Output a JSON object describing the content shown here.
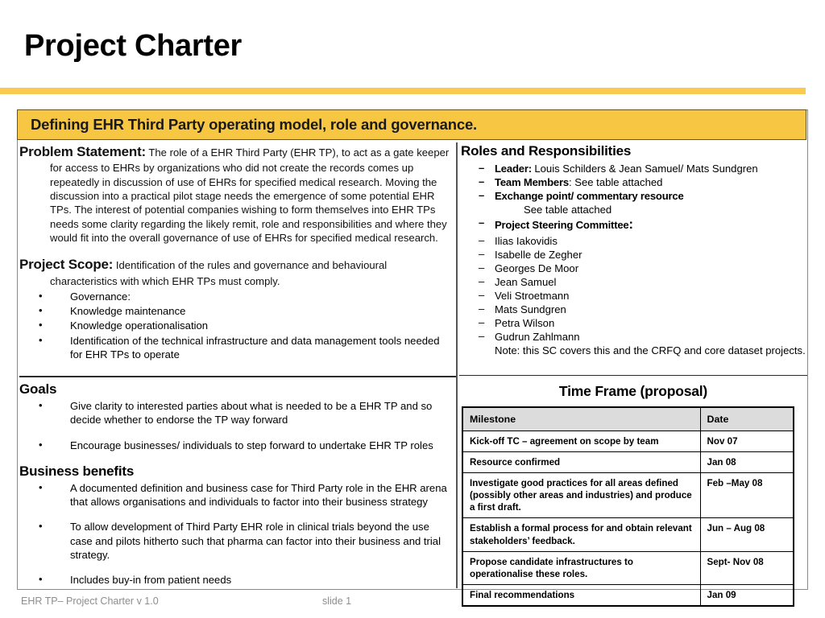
{
  "slide": {
    "title": "Project Charter",
    "banner": "Defining EHR Third Party operating model, role and governance.",
    "accent_color": "#FBCB4F",
    "banner_color": "#F7C642"
  },
  "problem": {
    "label": "Problem Statement:",
    "text": "The role of a EHR Third Party (EHR TP), to act as a gate keeper for access to EHRs by organizations who did not create the records comes up repeatedly in discussion of use of EHRs for specified medical research. Moving the discussion into a practical pilot stage needs the emergence of some potential EHR TPs. The interest of potential companies wishing to form themselves into EHR TPs needs some clarity regarding the likely remit, role and responsibilities and where they would fit into the overall governance of use of EHRs for specified medical research."
  },
  "scope": {
    "label": "Project Scope:",
    "text": "Identification of the rules and governance and behavioural characteristics with which EHR TPs must comply.",
    "items": [
      "Governance:",
      "Knowledge maintenance",
      "Knowledge operationalisation",
      "Identification of  the technical infrastructure and data management tools needed for EHR TPs to operate"
    ]
  },
  "roles": {
    "heading": "Roles and Responsibilities",
    "leader_label": "Leader:",
    "leader_value": "Louis Schilders & Jean Samuel/ Mats Sundgren",
    "team_label": "Team Members",
    "team_value": ": See table attached",
    "exchange_label": "Exchange point/ commentary resource",
    "exchange_value": "See table attached",
    "steering_label": "Project Steering Committee",
    "steering_label_colon": ":",
    "committee": [
      "Ilias Iakovidis",
      "Isabelle de Zegher",
      "Georges De Moor",
      "Jean Samuel",
      "Veli Stroetmann",
      "Mats Sundgren",
      "Petra Wilson",
      "Gudrun Zahlmann"
    ],
    "note": "Note: this SC covers this and the CRFQ and core dataset projects."
  },
  "goals": {
    "heading": "Goals",
    "items": [
      "Give clarity to interested parties about what is needed to be a EHR TP and so decide whether to endorse the TP way forward",
      "Encourage businesses/ individuals to step forward to undertake EHR TP roles"
    ]
  },
  "benefits": {
    "heading": "Business benefits",
    "items": [
      "A documented definition and business case for Third Party role in the EHR arena that allows organisations and individuals to factor into their business strategy",
      "To allow development of Third Party EHR role in clinical trials beyond the use case and pilots hitherto such that pharma can factor into their business and trial strategy.",
      "Includes buy-in from patient needs"
    ]
  },
  "timeframe": {
    "title": "Time Frame (proposal)",
    "columns": [
      "Milestone",
      "Date"
    ],
    "rows": [
      {
        "milestone": "Kick-off TC – agreement on scope by team",
        "date": "Nov 07"
      },
      {
        "milestone": "Resource confirmed",
        "date": "Jan 08"
      },
      {
        "milestone": "Investigate good practices for all areas defined (possibly other areas and industries) and produce a first draft.",
        "date": "Feb –May 08"
      },
      {
        "milestone": "Establish a formal process for and obtain relevant stakeholders’ feedback.",
        "date": "Jun – Aug 08"
      },
      {
        "milestone": "Propose candidate infrastructures to operationalise these roles.",
        "date": "Sept- Nov 08"
      },
      {
        "milestone": "Final recommendations",
        "date": "Jan 09"
      }
    ]
  },
  "footer": {
    "left": "EHR TP– Project Charter  v 1.0",
    "center": "slide 1"
  }
}
